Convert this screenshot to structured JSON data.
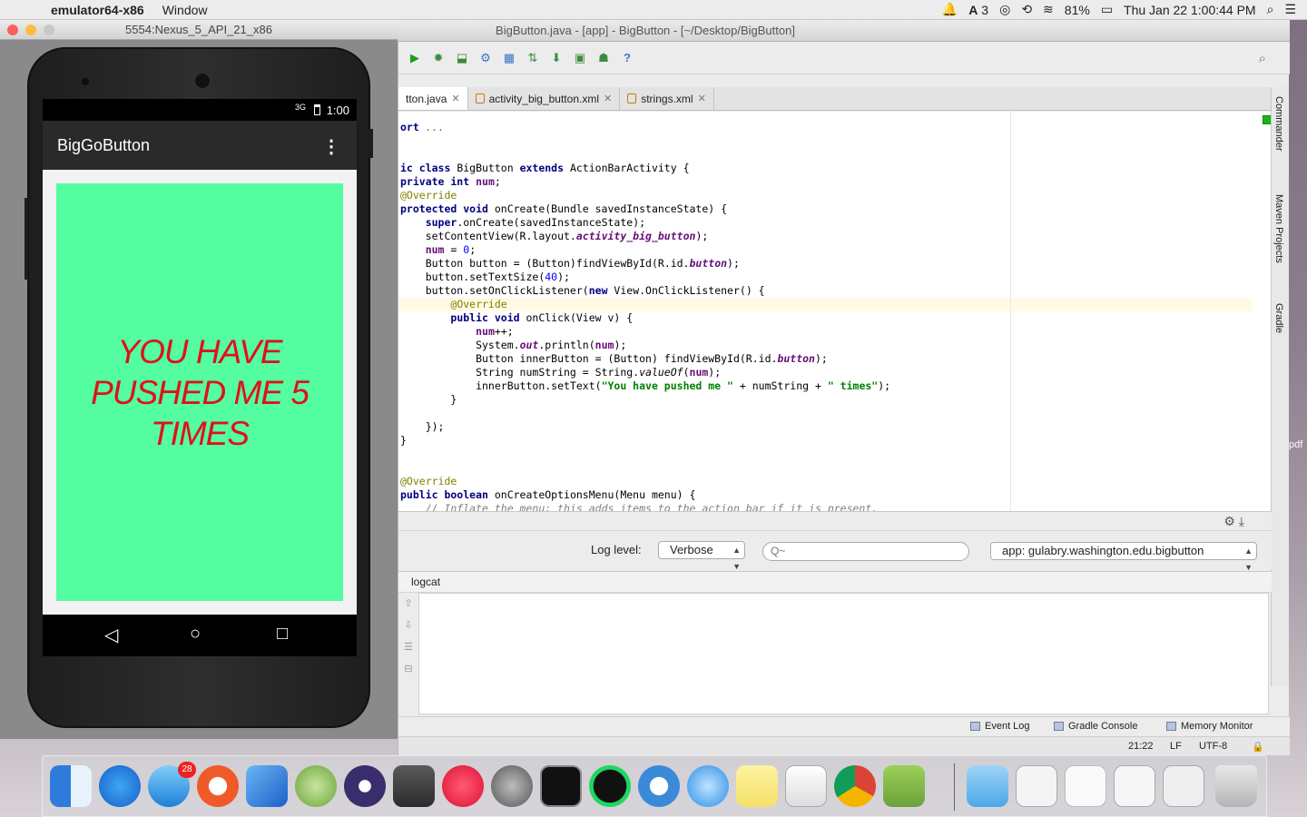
{
  "menubar": {
    "app_name": "emulator64-x86",
    "items": [
      "Window"
    ],
    "notification_count": "3",
    "battery": "81%",
    "datetime": "Thu Jan 22  1:00:44 PM"
  },
  "ide": {
    "window_title": "BigButton.java - [app] - BigButton - [~/Desktop/BigButton]",
    "tabs": [
      {
        "label": "tton.java"
      },
      {
        "label": "activity_big_button.xml"
      },
      {
        "label": "strings.xml"
      }
    ],
    "right_rail": [
      "Commander",
      "Maven Projects",
      "Gradle"
    ],
    "logcat": {
      "log_level_label": "Log level:",
      "log_level_value": "Verbose",
      "search_placeholder": "Q~",
      "app_filter": "app: gulabry.washington.edu.bigbutton",
      "header": "logcat"
    },
    "status_tools": [
      "Event Log",
      "Gradle Console",
      "Memory Monitor"
    ],
    "status": {
      "position": "21:22",
      "line_sep": "LF",
      "encoding": "UTF-8"
    }
  },
  "emulator": {
    "window_title": "5554:Nexus_5_API_21_x86",
    "status_time": "1:00",
    "signal": "3G",
    "app_title": "BigGoButton",
    "overflow": "⋮",
    "button_text": "YOU HAVE PUSHED ME 5 TIMES"
  },
  "dock": {
    "mail_badge": "28"
  },
  "desktop": {
    "edge_label": "pdf"
  }
}
